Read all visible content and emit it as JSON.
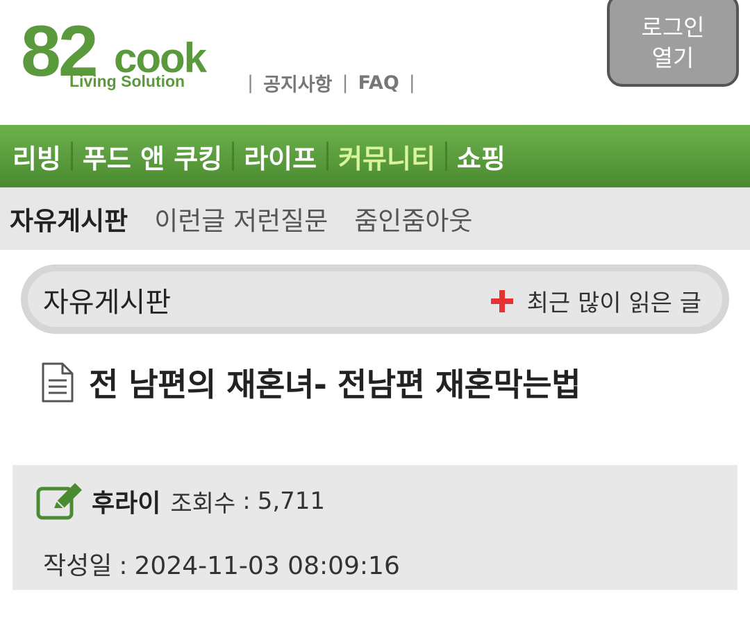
{
  "header": {
    "logo_number": "82",
    "logo_word": "cook",
    "logo_tagline": "Living Solution",
    "links": [
      "공지사항",
      "FAQ"
    ],
    "login_line1": "로그인",
    "login_line2": "열기"
  },
  "gnb": {
    "items": [
      "리빙",
      "푸드 앤 쿠킹",
      "라이프",
      "커뮤니티",
      "쇼핑"
    ],
    "active": "커뮤니티"
  },
  "lnb": {
    "items": [
      "자유게시판",
      "이런글 저런질문",
      "줌인줌아웃"
    ],
    "active": "자유게시판"
  },
  "board": {
    "title": "자유게시판",
    "recent_label": "최근 많이 읽은 글"
  },
  "post": {
    "title": "전 남편의 재혼녀- 전남편 재혼막는법",
    "author": "후라이",
    "views_label": "조회수",
    "views": "5,711",
    "date_label": "작성일",
    "date": "2024-11-03 08:09:16"
  },
  "colors": {
    "brand_green": "#5a9a3c",
    "active_nav": "#d8f59a",
    "plus_red": "#e53232"
  }
}
